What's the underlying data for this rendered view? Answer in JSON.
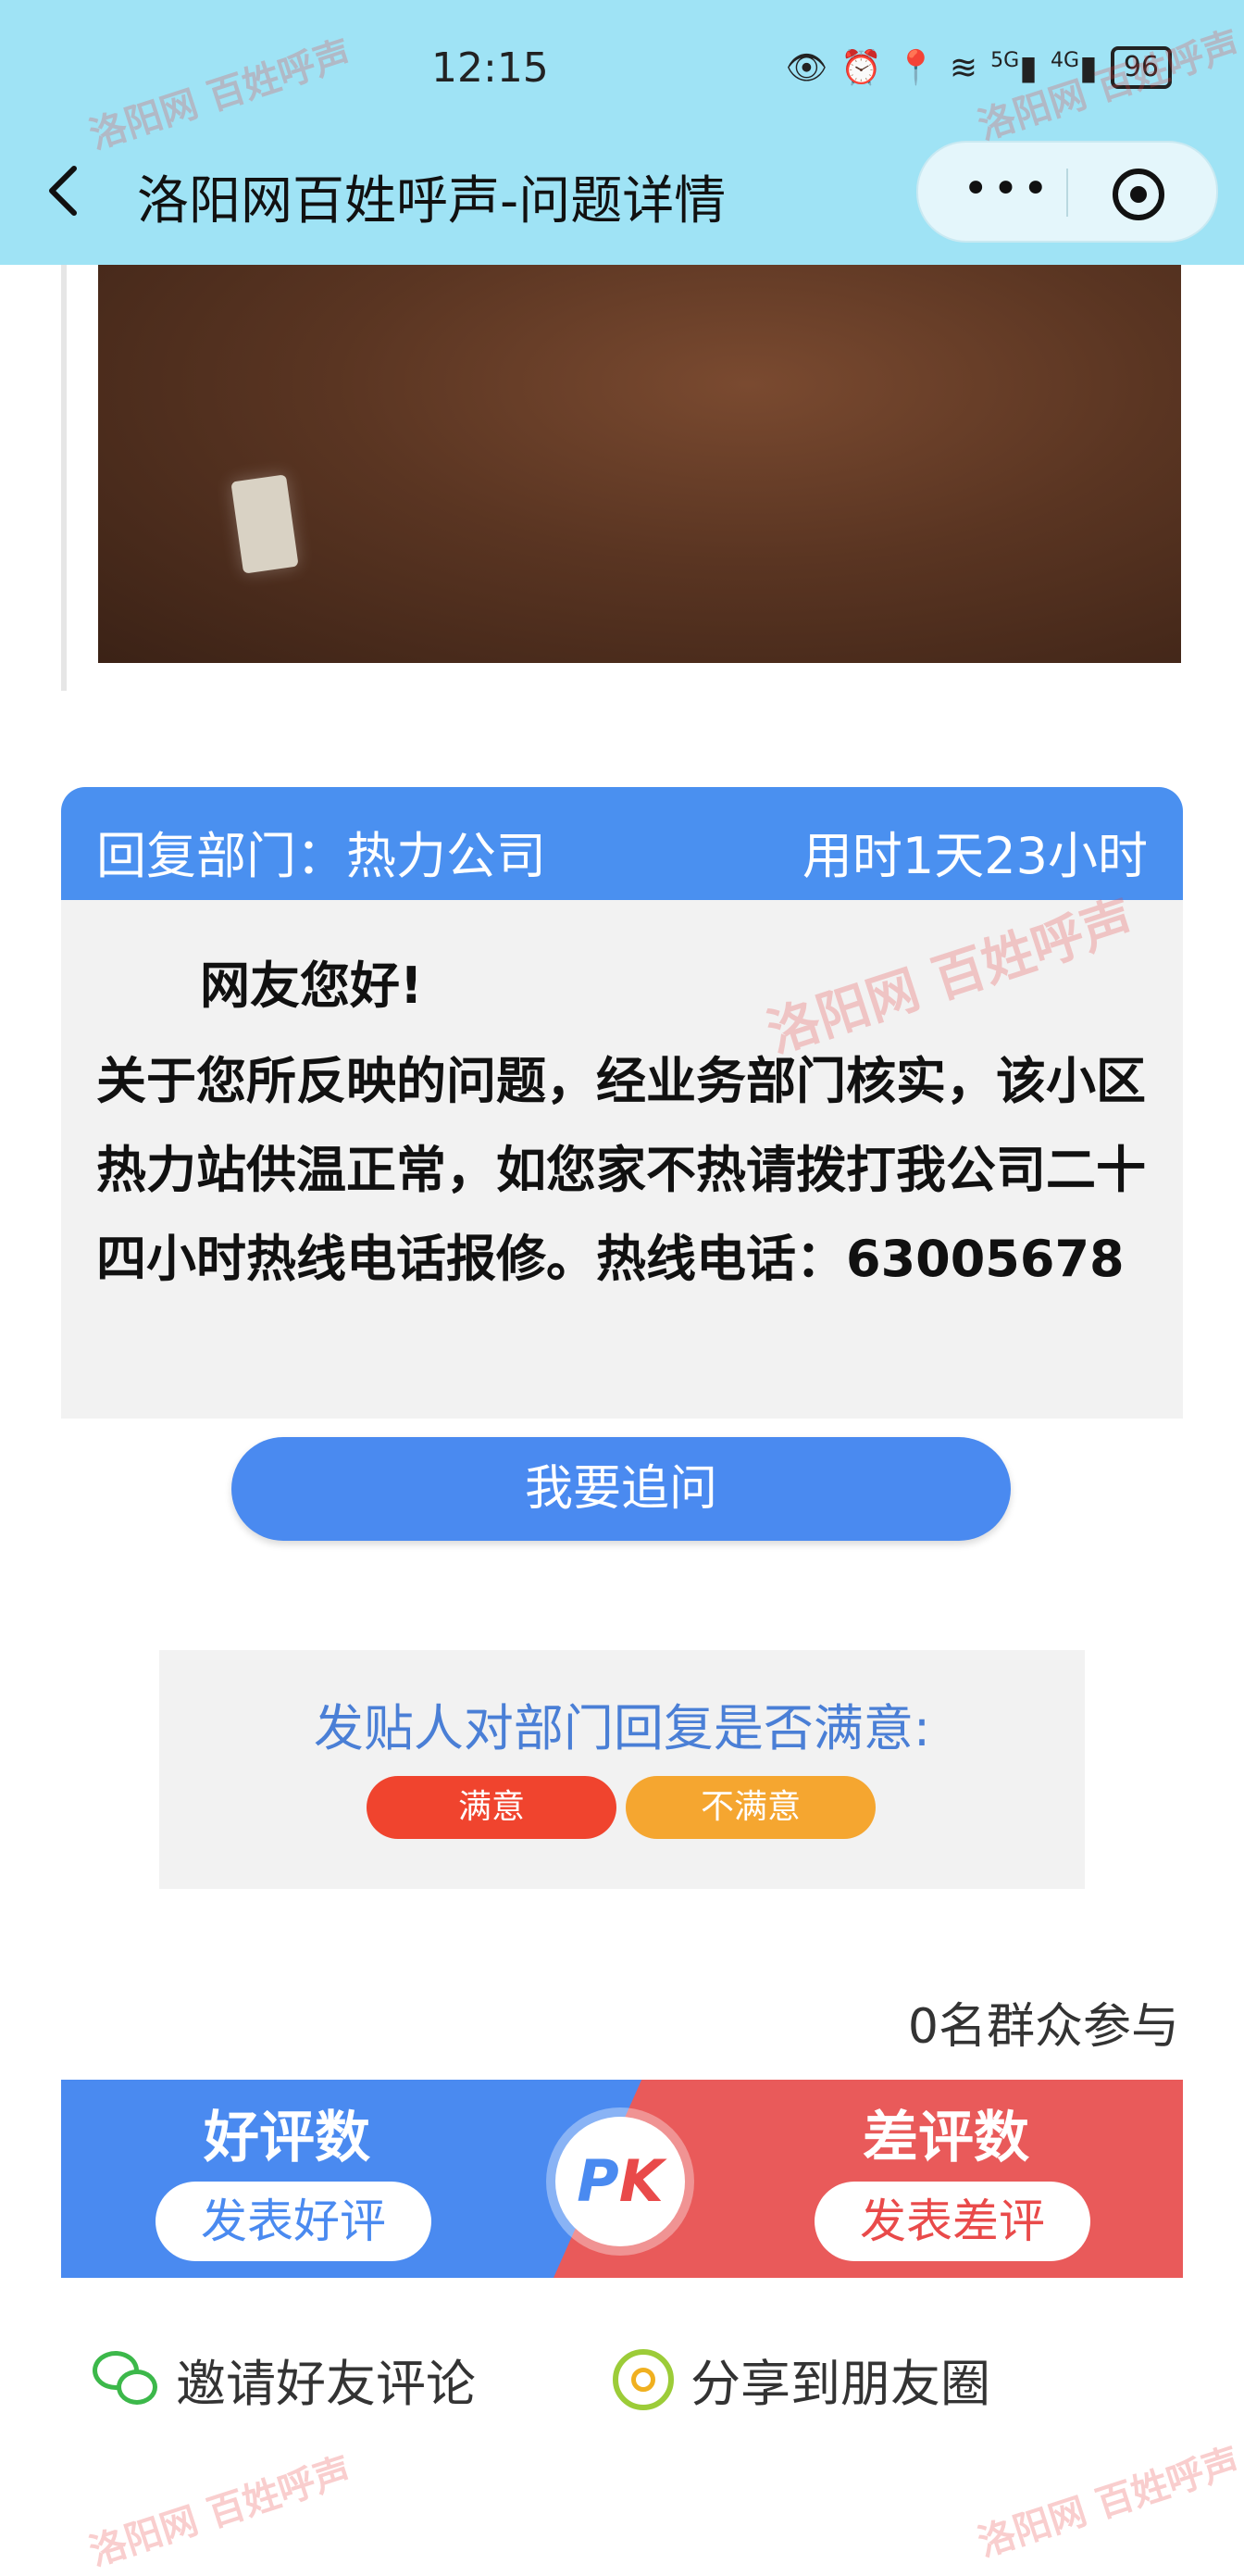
{
  "status_bar": {
    "time": "12:15",
    "network_5g": "5G",
    "network_4g": "4G",
    "battery": "96"
  },
  "nav": {
    "title": "洛阳网百姓呼声-问题详情",
    "menu_dots": "•••"
  },
  "reply": {
    "department": "回复部门：热力公司",
    "time_used": "用时1天23小时",
    "greeting": "网友您好!",
    "content": "关于您所反映的问题，经业务部门核实，该小区热力站供温正常，如您家不热请拨打我公司二十四小时热线电话报修。热线电话：63005678"
  },
  "followup_button": "我要追问",
  "satisfaction": {
    "question": "发贴人对部门回复是否满意:",
    "yes": "满意",
    "no": "不满意"
  },
  "participants": "0名群众参与",
  "pk": {
    "good_title": "好评数",
    "good_button": "发表好评",
    "bad_title": "差评数",
    "bad_button": "发表差评",
    "badge_p": "P",
    "badge_k": "K"
  },
  "share": {
    "invite": "邀请好友评论",
    "moments": "分享到朋友圈"
  },
  "watermark": "洛阳网 百姓呼声"
}
